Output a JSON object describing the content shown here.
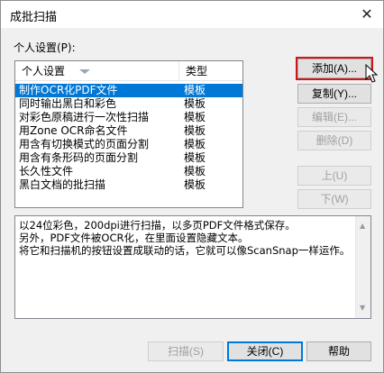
{
  "window": {
    "title": "成批扫描",
    "close_glyph": "✕"
  },
  "section": {
    "label": "个人设置(P):"
  },
  "list": {
    "columns": [
      "个人设置",
      "类型"
    ],
    "rows": [
      {
        "name": "制作OCR化PDF文件",
        "type": "模板",
        "selected": true
      },
      {
        "name": "同时输出黑白和彩色",
        "type": "模板"
      },
      {
        "name": "对彩色原稿进行一次性扫描",
        "type": "模板"
      },
      {
        "name": "用Zone OCR命名文件",
        "type": "模板"
      },
      {
        "name": "用含有切换模式的页面分割",
        "type": "模板"
      },
      {
        "name": "用含有条形码的页面分割",
        "type": "模板"
      },
      {
        "name": "长久性文件",
        "type": "模板"
      },
      {
        "name": "黑白文档的批扫描",
        "type": "模板"
      }
    ]
  },
  "side_buttons": {
    "add": "添加(A)...",
    "copy": "复制(Y)...",
    "edit": "编辑(E)...",
    "delete": "删除(D)",
    "up": "上(U)",
    "down": "下(W)"
  },
  "description": {
    "lines": [
      "以24位彩色，200dpi进行扫描，以多页PDF文件格式保存。",
      "另外，PDF文件被OCR化，在里面设置隐藏文本。",
      "将它和扫描机的按钮设置成联动的话，它就可以像ScanSnap一样运作。"
    ]
  },
  "footer": {
    "scan": "扫描(S)",
    "close": "关闭(C)",
    "help": "帮助"
  },
  "colors": {
    "selection": "#0078d7",
    "highlight_box": "#d0161c"
  }
}
